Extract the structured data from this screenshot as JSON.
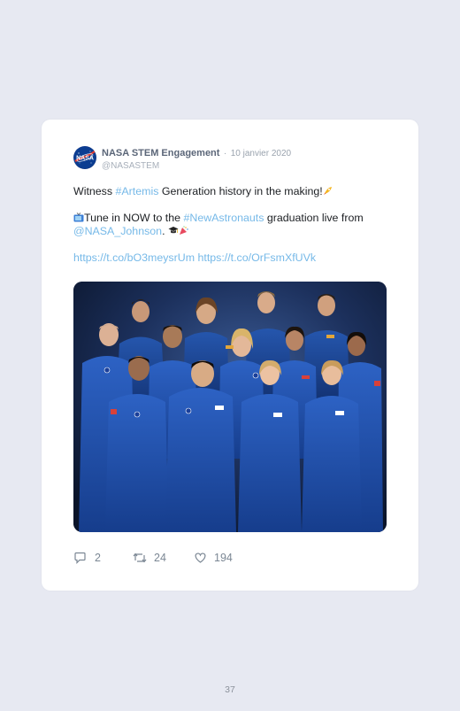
{
  "tweet": {
    "author": {
      "display_name": "NASA STEM Engagement",
      "separator": "·",
      "date": "10 janvier 2020",
      "handle": "@NASASTEM"
    },
    "text": {
      "line1_prefix": "Witness ",
      "hashtag_artemis": "#Artemis",
      "line1_suffix": " Generation history in the making!",
      "line2_prefix": "Tune in NOW to the ",
      "hashtag_new_astronauts": "#NewAstronauts",
      "line2_suffix": " graduation live from",
      "mention": "@NASA_Johnson",
      "line3_suffix": ".",
      "link1": "https://t.co/bO3meysrUm",
      "link2": "https://t.co/OrFsmXfUVk"
    },
    "stats": {
      "replies": "2",
      "retweets": "24",
      "likes": "194"
    },
    "icons": {
      "avatar": "nasa-meatball-logo",
      "emoji_rocket": "rocket-icon",
      "emoji_tv": "tv-icon",
      "emoji_graduation": "graduation-cap-icon",
      "emoji_party": "party-popper-icon",
      "reply": "reply-icon",
      "retweet": "retweet-icon",
      "like": "heart-icon"
    }
  },
  "footer": {
    "page_number": "37"
  },
  "colors": {
    "page_background": "#e7e9f2",
    "card_background": "#ffffff",
    "link": "#76b9e8",
    "muted": "#9aa3ae"
  }
}
